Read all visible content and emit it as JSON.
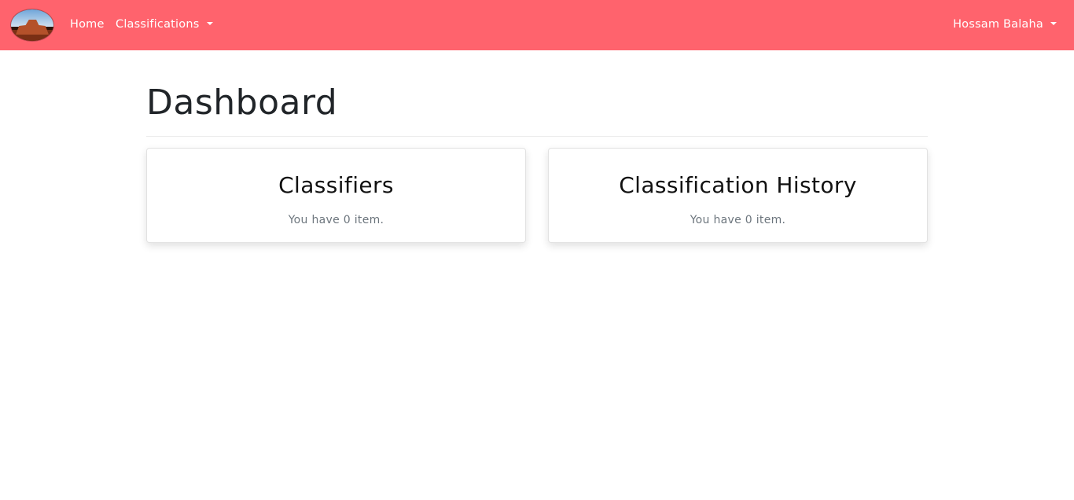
{
  "colors": {
    "navbar": "#ff636d",
    "nav_text": "#ffffff",
    "title_text": "#212529",
    "muted_text": "#6c757d"
  },
  "navbar": {
    "logo_icon": "red-rock-landscape-logo",
    "home_label": "Home",
    "classifications_label": "Classifications",
    "user_label": "Hossam Balaha"
  },
  "page": {
    "title": "Dashboard"
  },
  "cards": [
    {
      "title": "Classifiers",
      "text": "You have 0 item."
    },
    {
      "title": "Classification History",
      "text": "You have 0 item."
    }
  ]
}
